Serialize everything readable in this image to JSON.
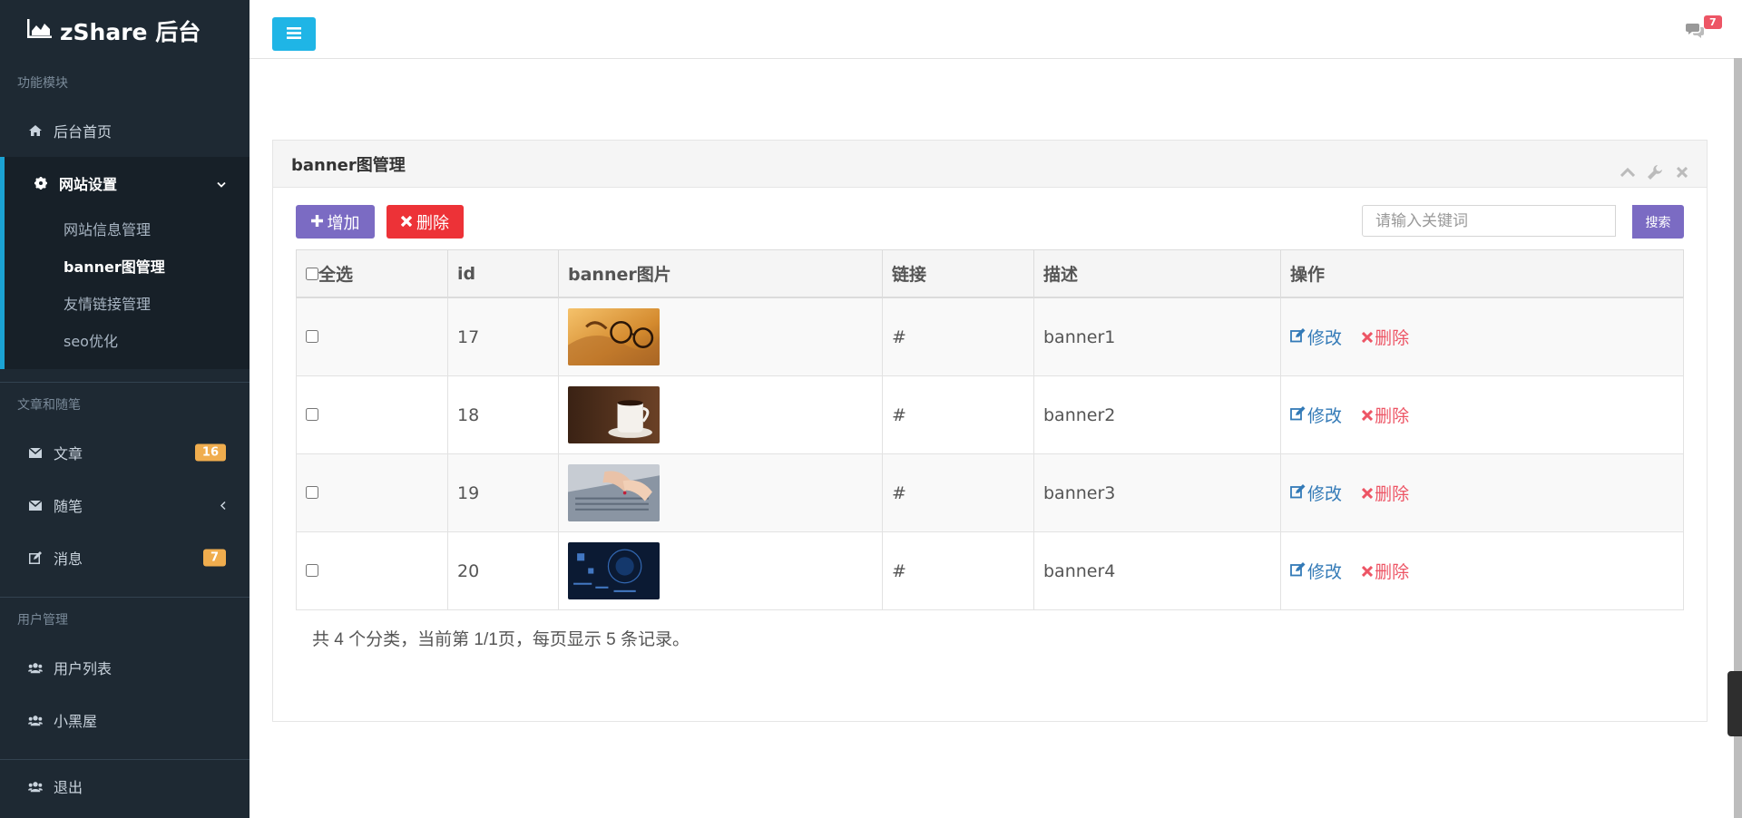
{
  "brand": {
    "title": "zShare 后台",
    "icon": "chart-area-icon"
  },
  "sidebar": {
    "section1": "功能模块",
    "home": "后台首页",
    "site_settings": "网站设置",
    "sub_items": [
      "网站信息管理",
      "banner图管理",
      "友情链接管理",
      "seo优化"
    ],
    "section2": "文章和随笔",
    "article": "文章",
    "article_badge": "16",
    "essay": "随笔",
    "message": "消息",
    "message_badge": "7",
    "section3": "用户管理",
    "user_list": "用户列表",
    "blacklist": "小黑屋",
    "logout": "退出"
  },
  "topbar": {
    "message_count": "7"
  },
  "panel": {
    "title": "banner图管理",
    "add_label": "增加",
    "delete_label": "删除",
    "search_placeholder": "请输入关键词",
    "search_label": "搜索"
  },
  "table": {
    "headers": [
      "全选",
      "id",
      "banner图片",
      "链接",
      "描述",
      "操作"
    ],
    "rows": [
      {
        "id": "17",
        "link": "#",
        "desc": "banner1",
        "image": "glasses-on-map"
      },
      {
        "id": "18",
        "link": "#",
        "desc": "banner2",
        "image": "coffee-cup"
      },
      {
        "id": "19",
        "link": "#",
        "desc": "banner3",
        "image": "typing-on-laptop"
      },
      {
        "id": "20",
        "link": "#",
        "desc": "banner4",
        "image": "tech-blue"
      }
    ],
    "edit_label": "修改",
    "delete_label": "删除"
  },
  "summary": "共 4 个分类，当前第 1/1页，每页显示 5 条记录。",
  "colors": {
    "accent": "#7b6bc3",
    "danger": "#ed3237",
    "info": "#1fb5e6",
    "sidebar": "#1e2933",
    "badge": "#f0ad4e"
  }
}
